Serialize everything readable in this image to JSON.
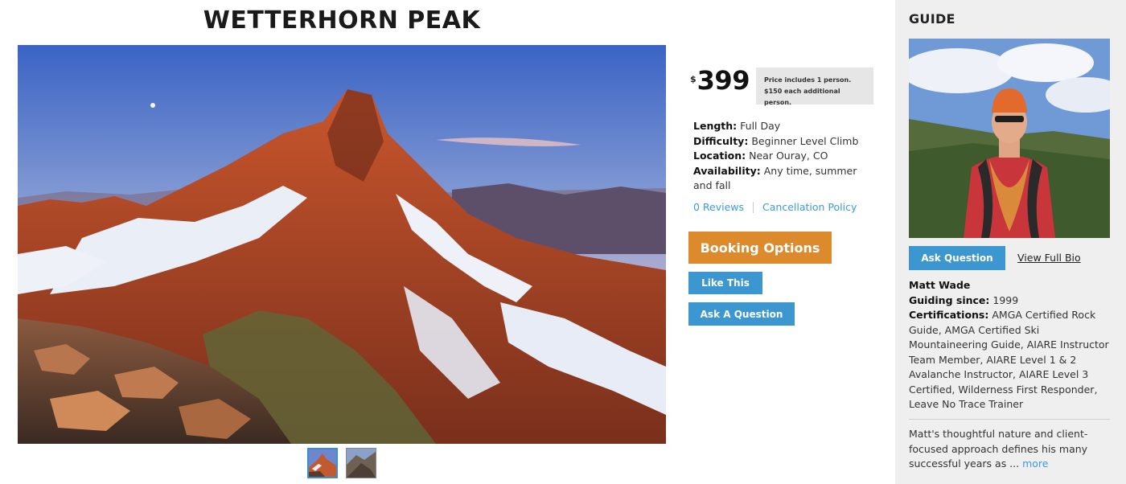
{
  "page": {
    "title": "WETTERHORN PEAK"
  },
  "gallery": {
    "thumbnails": [
      "thumbnail-peak",
      "thumbnail-rock"
    ],
    "active_index": 0
  },
  "pricing": {
    "currency": "$",
    "price": "399",
    "note_line1": "Price includes 1 person.",
    "note_line2": "$150 each additional person."
  },
  "details": [
    {
      "label": "Length:",
      "value": "Full Day"
    },
    {
      "label": "Difficulty:",
      "value": "Beginner Level Climb"
    },
    {
      "label": "Location:",
      "value": "Near Ouray, CO"
    },
    {
      "label": "Availability:",
      "value": "Any time, summer and fall"
    }
  ],
  "links": {
    "reviews": "0 Reviews",
    "cancellation": "Cancellation Policy"
  },
  "buttons": {
    "booking": "Booking Options",
    "like": "Like This",
    "ask": "Ask A Question"
  },
  "guide": {
    "heading": "GUIDE",
    "ask_button": "Ask Question",
    "bio_link": "View Full Bio",
    "name": "Matt Wade",
    "since_label": "Guiding since:",
    "since_value": "1999",
    "cert_label": "Certifications:",
    "cert_value": "AMGA Certified Rock Guide, AMGA Certified Ski Mountaineering Guide, AIARE Instructor Team Member, AIARE Level 1 & 2 Avalanche Instructor, AIARE Level 3 Certified, Wilderness First Responder, Leave No Trace Trainer",
    "description": "Matt's thoughtful nature and client-focused approach defines his many successful years as ...",
    "more": "more"
  },
  "colors": {
    "accent_orange": "#dd8a2c",
    "accent_blue": "#3c96d0",
    "link_blue": "#3b9bd6"
  },
  "icons": {
    "currency": "dollar-sign"
  }
}
